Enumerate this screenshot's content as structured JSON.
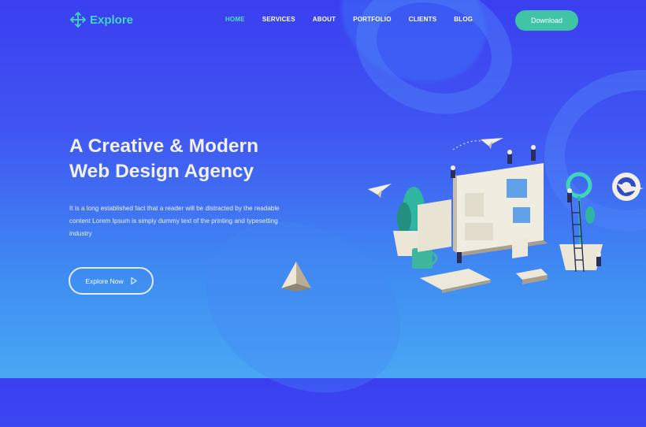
{
  "brand": {
    "name": "Explore",
    "accent": "#3fd6c2"
  },
  "nav": {
    "items": [
      {
        "label": "HOME",
        "active": true
      },
      {
        "label": "SERVICES",
        "active": false
      },
      {
        "label": "ABOUT",
        "active": false
      },
      {
        "label": "PORTFOLIO",
        "active": false
      },
      {
        "label": "CLIENTS",
        "active": false
      },
      {
        "label": "BLOG",
        "active": false
      }
    ]
  },
  "header": {
    "download_label": "Download",
    "download_color": "#3fc4a6"
  },
  "hero": {
    "title_line1": "A Creative & Modern",
    "title_line2": "Web Design Agency",
    "description": "It is a long established fact that a reader will be distracted by the readable content Lorem Ipsum is simply dummy text of the printing and typesetting industry",
    "cta_label": "Explore Now",
    "cta_icon": "play-icon"
  },
  "decor": {
    "pyramid_icon": "triangle-icon",
    "illustration": "isometric-web-design-illustration"
  }
}
